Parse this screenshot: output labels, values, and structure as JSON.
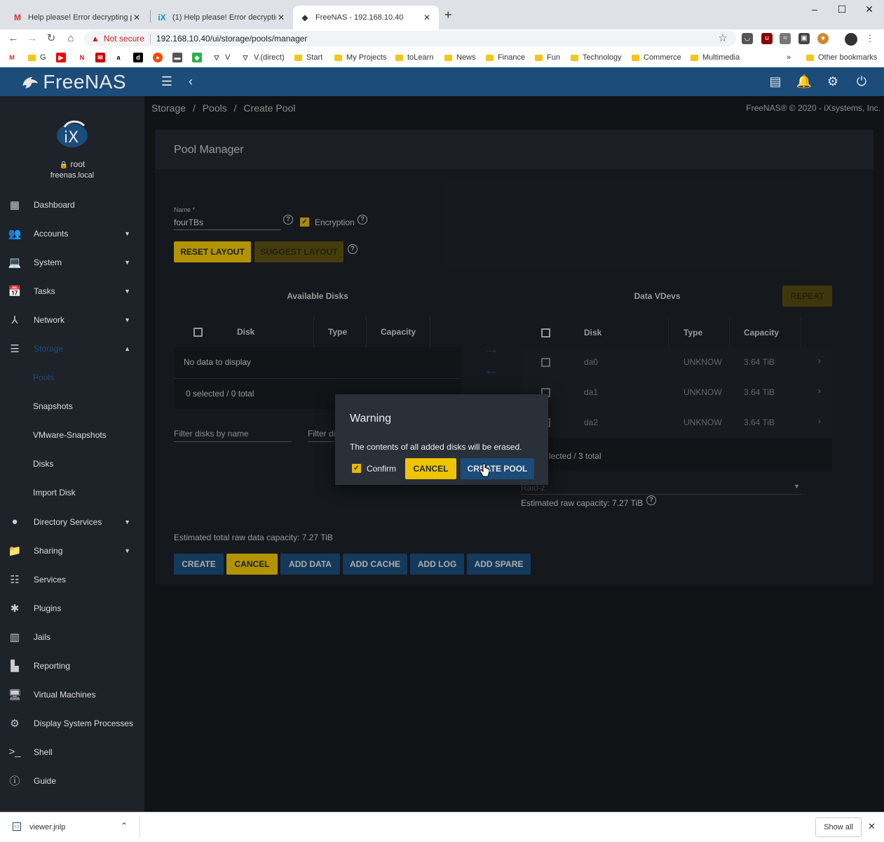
{
  "browser": {
    "tabs": [
      {
        "title": "Help please! Error decrypting po",
        "icon": "gmail-icon"
      },
      {
        "title": "(1) Help please! Error decrypting",
        "icon": "ix-icon"
      },
      {
        "title": "FreeNAS - 192.168.10.40",
        "icon": "freenas-icon"
      }
    ],
    "url_warning": "Not secure",
    "url": "192.168.10.40/ui/storage/pools/manager",
    "bookmarks": [
      "G",
      "V",
      "V.(direct)",
      "Start",
      "My Projects",
      "toLearn",
      "News",
      "Finance",
      "Fun",
      "Technology",
      "Commerce",
      "Multimedia"
    ],
    "bookmarks_more": "»",
    "other_bookmarks": "Other bookmarks"
  },
  "app": {
    "logo_text": "FreeNAS",
    "user": {
      "name": "root",
      "host": "freenas.local",
      "avatar_text": "iX"
    },
    "breadcrumb": [
      "Storage",
      "/",
      "Pools",
      "/",
      "Create Pool"
    ],
    "copyright": "FreeNAS® © 2020 - iXsystems, Inc.",
    "nav": [
      {
        "label": "Dashboard",
        "icon": "dashboard-icon"
      },
      {
        "label": "Accounts",
        "icon": "accounts-icon"
      },
      {
        "label": "System",
        "icon": "system-icon"
      },
      {
        "label": "Tasks",
        "icon": "tasks-icon"
      },
      {
        "label": "Network",
        "icon": "network-icon"
      },
      {
        "label": "Storage",
        "icon": "storage-icon"
      },
      {
        "label": "Directory Services",
        "icon": "directory-icon"
      },
      {
        "label": "Sharing",
        "icon": "sharing-icon"
      },
      {
        "label": "Services",
        "icon": "services-icon"
      },
      {
        "label": "Plugins",
        "icon": "plugins-icon"
      },
      {
        "label": "Jails",
        "icon": "jails-icon"
      },
      {
        "label": "Reporting",
        "icon": "reporting-icon"
      },
      {
        "label": "Virtual Machines",
        "icon": "vm-icon"
      },
      {
        "label": "Display System Processes",
        "icon": "processes-icon"
      },
      {
        "label": "Shell",
        "icon": "shell-icon"
      },
      {
        "label": "Guide",
        "icon": "guide-icon"
      }
    ],
    "storage_sub": [
      "Pools",
      "Snapshots",
      "VMware-Snapshots",
      "Disks",
      "Import Disk"
    ]
  },
  "pool": {
    "title": "Pool Manager",
    "name_label": "Name *",
    "name_value": "fourTBs",
    "encryption_label": "Encryption",
    "reset_layout": "RESET LAYOUT",
    "suggest_layout": "SUGGEST LAYOUT",
    "available_title": "Available Disks",
    "available_headers": [
      "Disk",
      "Type",
      "Capacity"
    ],
    "available_empty": "No data to display",
    "available_footer": "0 selected / 0 total",
    "filter_name": "Filter disks by name",
    "filter_other": "Filter di",
    "vdev_title": "Data VDevs",
    "repeat": "REPEAT",
    "vdev_headers": [
      "Disk",
      "Type",
      "Capacity"
    ],
    "vdev_rows": [
      {
        "disk": "da0",
        "type": "UNKNOW",
        "capacity": "3.64 TiB"
      },
      {
        "disk": "da1",
        "type": "UNKNOW",
        "capacity": "3.64 TiB"
      },
      {
        "disk": "da2",
        "type": "UNKNOW",
        "capacity": "3.64 TiB"
      }
    ],
    "vdev_footer": "lected / 3 total",
    "layout_value": "Raid-z",
    "estimated_raw": "Estimated raw capacity: 7.27 TiB",
    "estimated_total": "Estimated total raw data capacity: 7.27 TiB",
    "buttons": [
      "CREATE",
      "CANCEL",
      "ADD DATA",
      "ADD CACHE",
      "ADD LOG",
      "ADD SPARE"
    ]
  },
  "dialog": {
    "title": "Warning",
    "message": "The contents of all added disks will be erased.",
    "confirm_label": "Confirm",
    "cancel": "CANCEL",
    "create_pool": "CREATE POOL"
  },
  "download": {
    "file": "viewer.jnlp",
    "show_all": "Show all"
  }
}
